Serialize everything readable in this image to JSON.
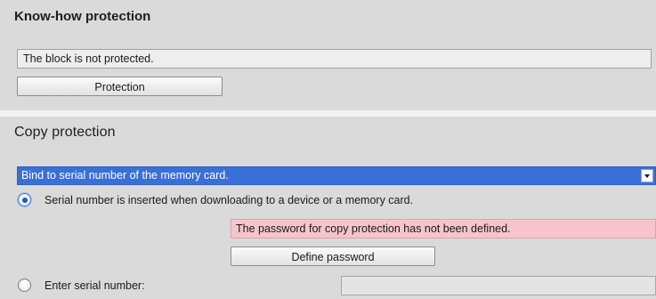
{
  "know_how": {
    "title": "Know-how protection",
    "status_text": "The block is not protected.",
    "protection_button_label": "Protection"
  },
  "copy_protection": {
    "title": "Copy protection",
    "mode_select": {
      "selected": "Bind to serial number of the memory card.",
      "icon": "chevron-down-icon"
    },
    "options": [
      {
        "label": "Serial number is inserted when downloading to a device or a memory card.",
        "checked": true
      },
      {
        "label": "Enter serial number:",
        "checked": false
      }
    ],
    "password_warning": "The password for copy protection has not been defined.",
    "define_password_button_label": "Define password",
    "serial_number_value": ""
  },
  "colors": {
    "selection_blue": "#3a6fd8",
    "warning_pink": "#f7c4cc",
    "panel_gray": "#dadada"
  }
}
